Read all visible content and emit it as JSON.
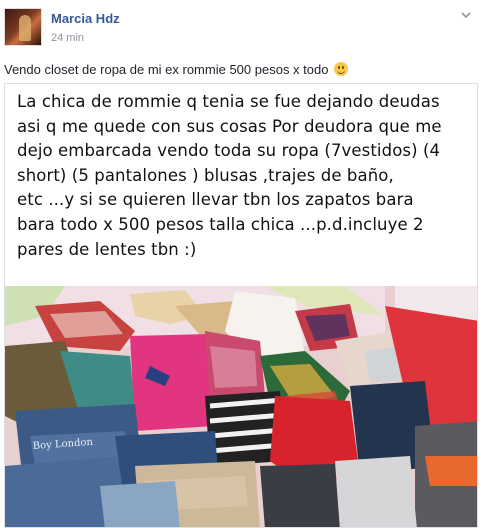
{
  "post": {
    "author": "Marcia Hdz",
    "timestamp": "24 min",
    "caption": "Vendo closet de ropa de mi ex rommie 500 pesos x todo",
    "image_text": "La chica de rommie q tenia se fue dejando deudas\nasi q me quede con sus cosas Por deudora que me\ndejo embarcada vendo toda su ropa (7vestidos) (4\nshort) (5 pantalones ) blusas ,trajes de baño,\netc ...y si se quieren llevar tbn los zapatos bara\nbara todo x 500 pesos talla chica ...p.d.incluye 2\npares de lentes tbn :)",
    "photo_text": "Boy London"
  },
  "icons": {
    "options": "chevron-down-icon",
    "emoji": "smile-emoji-icon"
  },
  "colors": {
    "author": "#365899",
    "timestamp": "#90949c",
    "text": "#1d2129"
  }
}
